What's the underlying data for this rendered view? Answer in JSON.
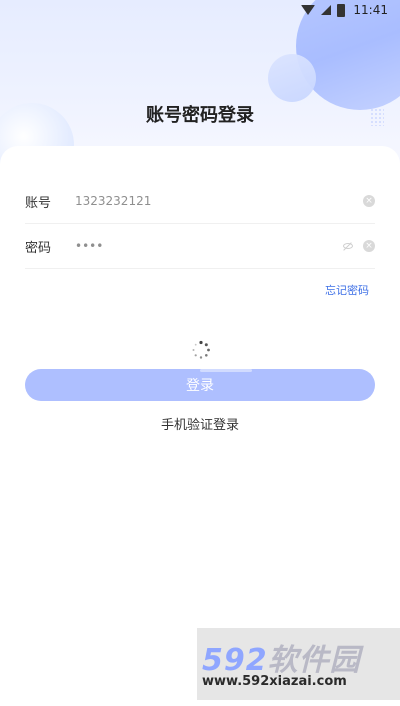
{
  "status_bar": {
    "time": "11:41"
  },
  "page": {
    "title": "账号密码登录"
  },
  "form": {
    "account_label": "账号",
    "account_value": "1323232121",
    "password_label": "密码",
    "password_value": "••••",
    "forgot_label": "忘记密码",
    "login_label": "登录",
    "sms_login_label": "手机验证登录"
  },
  "watermark": {
    "logo_number": "592",
    "logo_text": "软件园",
    "url": "www.592xiazai.com"
  },
  "colors": {
    "accent": "#3d6fe6",
    "button_disabled": "#aebfff",
    "hero_bg": "#e6ecff"
  },
  "icons": {
    "clear": "clear-icon",
    "visibility": "eye-off-icon",
    "loading": "loading-spinner-icon"
  }
}
